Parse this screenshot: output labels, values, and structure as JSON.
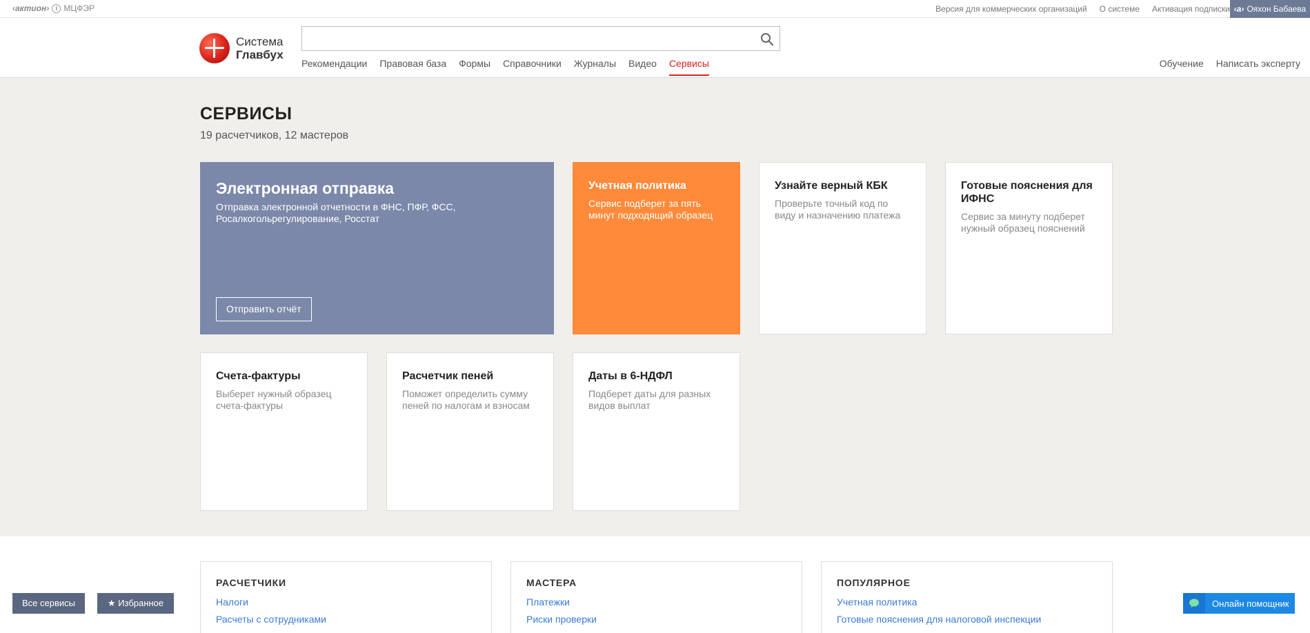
{
  "topbar": {
    "brand_left": "актион",
    "brand_right": "МЦФЭР",
    "links": [
      "Версия для коммерческих организаций",
      "О системе",
      "Активация подписки"
    ],
    "user_prefix": "а",
    "user_name": "Ояхон Бабаева"
  },
  "header": {
    "logo_line1": "Система",
    "logo_line2": "Главбух",
    "search_placeholder": "",
    "nav": [
      "Рекомендации",
      "Правовая база",
      "Формы",
      "Справочники",
      "Журналы",
      "Видео",
      "Сервисы"
    ],
    "nav_active": "Сервисы",
    "nav_right": [
      "Обучение",
      "Написать эксперту"
    ]
  },
  "main": {
    "title": "СЕРВИСЫ",
    "subtitle": "19 расчетчиков, 12 мастеров",
    "big_card": {
      "title": "Электронная отправка",
      "desc": "Отправка электронной отчетности в ФНС, ПФР, ФСС, Росалкогольрегулирование, Росстат",
      "button": "Отправить отчёт"
    },
    "cards": [
      {
        "title": "Учетная политика",
        "desc": "Сервис подберет за пять минут подходящий образец"
      },
      {
        "title": "Узнайте верный КБК",
        "desc": "Проверьте точный код по виду и назначению платежа"
      },
      {
        "title": "Готовые пояснения для ИФНС",
        "desc": "Сервис за минуту подберет нужный образец пояснений"
      },
      {
        "title": "Счета-фактуры",
        "desc": "Выберет нужный образец счета-фактуры"
      },
      {
        "title": "Расчетчик пеней",
        "desc": "Поможет определить сумму пеней по налогам и взносам"
      },
      {
        "title": "Даты в 6-НДФЛ",
        "desc": "Подберет даты для разных видов выплат"
      }
    ]
  },
  "bottom": {
    "columns": [
      {
        "title": "РАСЧЕТЧИКИ",
        "links": [
          "Налоги",
          "Расчеты с сотрудниками"
        ]
      },
      {
        "title": "МАСТЕРА",
        "links": [
          "Платежки",
          "Риски проверки"
        ]
      },
      {
        "title": "ПОПУЛЯРНОЕ",
        "links": [
          "Учетная политика",
          "Готовые пояснения для налоговой инспекции"
        ]
      }
    ],
    "all_services": "Все сервисы",
    "favorites": "Избранное",
    "helper": "Онлайн помощник"
  },
  "colors": {
    "accent_red": "#d8231c",
    "card_blue": "#7b88a9",
    "card_orange": "#ff8a3a",
    "link_blue": "#3a7bd5",
    "helper_blue": "#1e88e5"
  }
}
